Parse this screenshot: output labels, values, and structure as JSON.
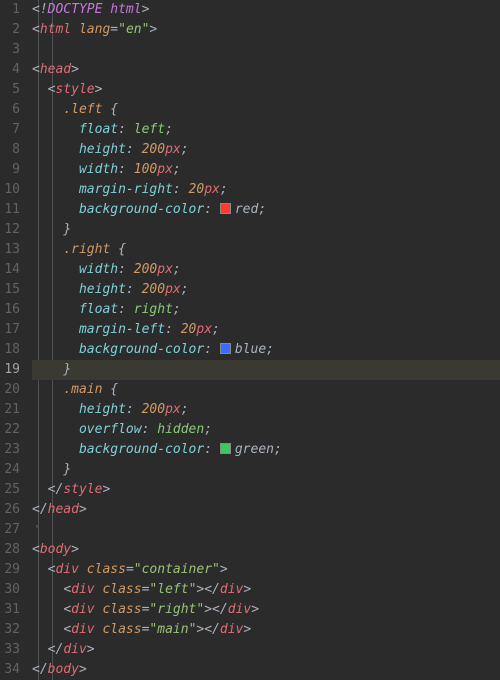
{
  "lines": [
    {
      "n": 1
    },
    {
      "n": 2
    },
    {
      "n": 3
    },
    {
      "n": 4
    },
    {
      "n": 5
    },
    {
      "n": 6
    },
    {
      "n": 7
    },
    {
      "n": 8
    },
    {
      "n": 9
    },
    {
      "n": 10
    },
    {
      "n": 11
    },
    {
      "n": 12
    },
    {
      "n": 13
    },
    {
      "n": 14
    },
    {
      "n": 15
    },
    {
      "n": 16
    },
    {
      "n": 17
    },
    {
      "n": 18
    },
    {
      "n": 19
    },
    {
      "n": 20
    },
    {
      "n": 21
    },
    {
      "n": 22
    },
    {
      "n": 23
    },
    {
      "n": 24
    },
    {
      "n": 25
    },
    {
      "n": 26
    },
    {
      "n": 27
    },
    {
      "n": 28
    },
    {
      "n": 29
    },
    {
      "n": 30
    },
    {
      "n": 31
    },
    {
      "n": 32
    },
    {
      "n": 33
    },
    {
      "n": 34
    }
  ],
  "active_line": 19,
  "doc": {
    "doctype": "DOCTYPE html",
    "html_attr_name": "lang",
    "html_attr_val": "en",
    "tags": {
      "html": "html",
      "head": "head",
      "style": "style",
      "body": "body",
      "div": "div"
    },
    "div_attr": "class",
    "div_classes": {
      "container": "container",
      "left": "left",
      "right": "right",
      "main": "main"
    }
  },
  "css": {
    "selectors": {
      "left": ".left",
      "right": ".right",
      "main": ".main"
    },
    "props": {
      "float": "float",
      "height": "height",
      "width": "width",
      "margin_right": "margin-right",
      "margin_left": "margin-left",
      "background_color": "background-color",
      "overflow": "overflow"
    },
    "values": {
      "left": "left",
      "right": "right",
      "hidden": "hidden",
      "h200": "200",
      "w100": "100",
      "w200": "200",
      "m20": "20",
      "px": "px",
      "red": "red",
      "blue": "blue",
      "green": "green"
    }
  },
  "marker": "'"
}
